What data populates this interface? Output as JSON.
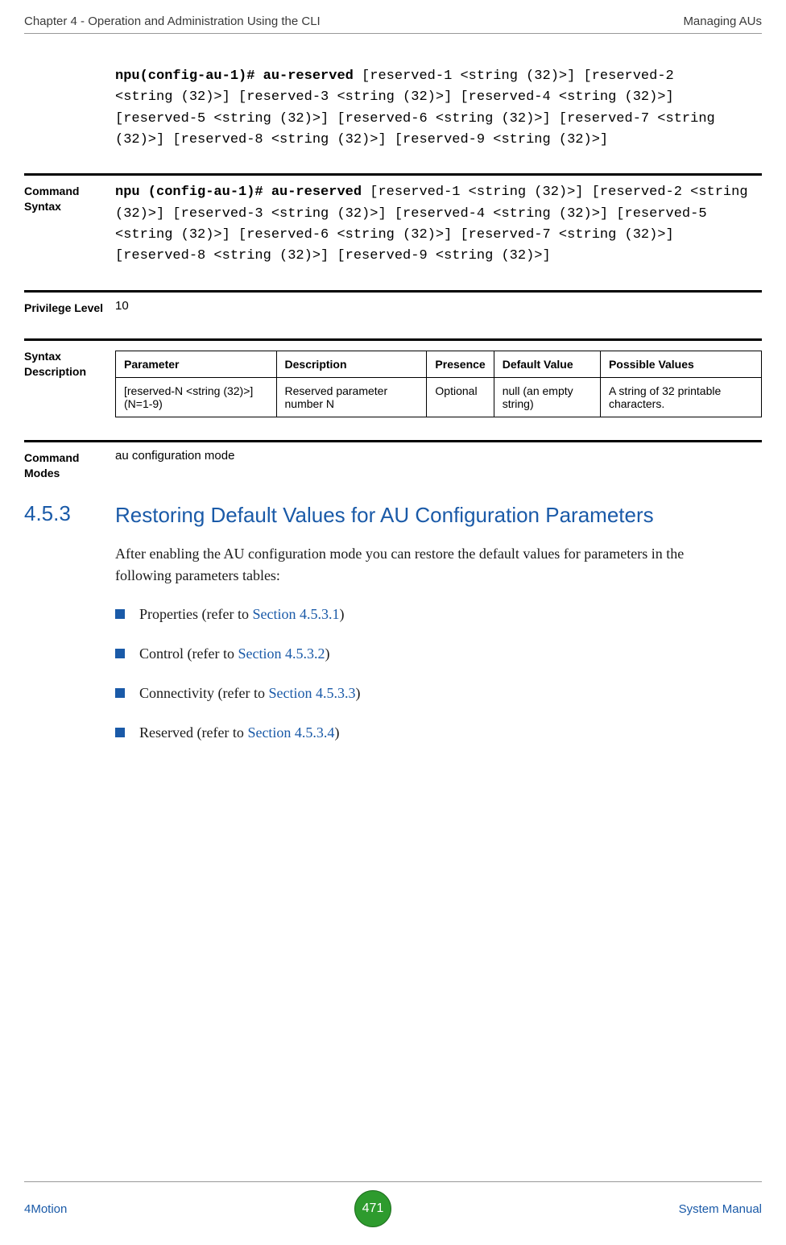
{
  "header": {
    "left": "Chapter 4 - Operation and Administration Using the CLI",
    "right": "Managing AUs"
  },
  "example_cmd": {
    "prefix": "npu(config-au-1)# au-reserved",
    "rest": " [reserved-1 <string (32)>] [reserved-2 <string (32)>] [reserved-3 <string (32)>] [reserved-4 <string (32)>] [reserved-5 <string (32)>] [reserved-6 <string (32)>] [reserved-7 <string (32)>] [reserved-8 <string (32)>] [reserved-9 <string (32)>]"
  },
  "command_syntax": {
    "label": "Command Syntax",
    "prefix": "npu (config-au-1)# au-reserved",
    "rest": " [reserved-1 <string (32)>] [reserved-2 <string (32)>] [reserved-3 <string (32)>] [reserved-4 <string (32)>] [reserved-5 <string (32)>] [reserved-6 <string (32)>] [reserved-7 <string (32)>] [reserved-8 <string (32)>] [reserved-9 <string (32)>]"
  },
  "privilege": {
    "label": "Privilege Level",
    "value": "10"
  },
  "syntax_desc": {
    "label": "Syntax Description",
    "headers": [
      "Parameter",
      "Description",
      "Presence",
      "Default Value",
      "Possible Values"
    ],
    "row": {
      "param": "[reserved-N <string (32)>] (N=1-9)",
      "desc": "Reserved parameter number N",
      "presence": "Optional",
      "default": "null (an empty string)",
      "possible": "A string of 32 printable characters."
    }
  },
  "command_modes": {
    "label": "Command Modes",
    "value": "au configuration mode"
  },
  "section": {
    "number": "4.5.3",
    "title": "Restoring Default Values for AU Configuration Parameters",
    "intro": "After enabling the AU configuration mode you can restore the default values for parameters in the following parameters tables:",
    "items": [
      {
        "text": "Properties (refer to ",
        "link": "Section 4.5.3.1",
        "suffix": ")"
      },
      {
        "text": "Control (refer to ",
        "link": "Section 4.5.3.2",
        "suffix": ")"
      },
      {
        "text": "Connectivity (refer to ",
        "link": "Section 4.5.3.3",
        "suffix": ")"
      },
      {
        "text": "Reserved (refer to ",
        "link": "Section 4.5.3.4",
        "suffix": ")"
      }
    ]
  },
  "footer": {
    "left": "4Motion",
    "page": "471",
    "right": "System Manual"
  }
}
